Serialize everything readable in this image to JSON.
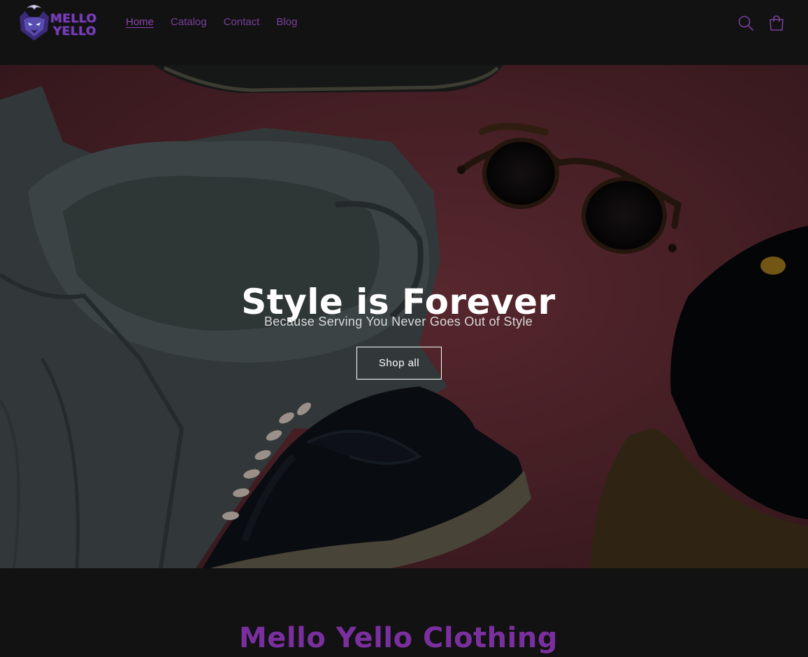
{
  "brand": {
    "logo_line1": "MELLO",
    "logo_line2": "YELLO",
    "accent_color": "#7a3f9b"
  },
  "nav": {
    "items": [
      {
        "label": "Home",
        "active": true
      },
      {
        "label": "Catalog",
        "active": false
      },
      {
        "label": "Contact",
        "active": false
      },
      {
        "label": "Blog",
        "active": false
      }
    ]
  },
  "header_icons": {
    "search": "search-icon",
    "cart": "cart-icon"
  },
  "hero": {
    "title": "Style is Forever",
    "subtitle": "Because Serving You Never Goes Out of Style",
    "cta_label": "Shop all"
  },
  "section": {
    "title": "Mello Yello Clothing"
  }
}
